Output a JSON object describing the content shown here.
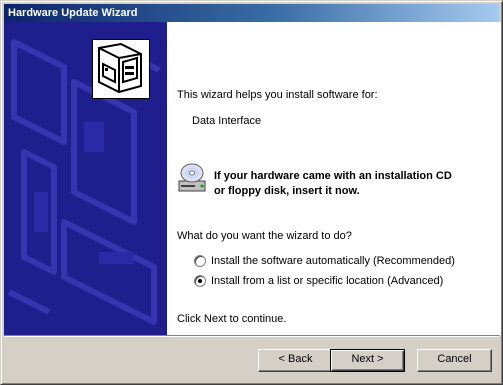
{
  "window": {
    "title": "Hardware Update Wizard"
  },
  "content": {
    "intro": "This wizard helps you install software for:",
    "device_name": "Data Interface",
    "notice_line1": "If your hardware came with an installation CD",
    "notice_line2": "or floppy disk, insert it now.",
    "question": "What do you want the wizard to do?",
    "options": [
      {
        "label": "Install the software automatically (Recommended)",
        "selected": false
      },
      {
        "label": "Install from a list or specific location (Advanced)",
        "selected": true
      }
    ],
    "footer": "Click Next to continue."
  },
  "buttons": {
    "back": "< Back",
    "next": "Next >",
    "cancel": "Cancel"
  },
  "colors": {
    "left_panel": "#1e1e8c",
    "titlebar_start": "#0a246a",
    "titlebar_end": "#a6caf0"
  },
  "icons": {
    "wizard": "hardware-card-icon",
    "cd": "cd-drive-icon"
  }
}
